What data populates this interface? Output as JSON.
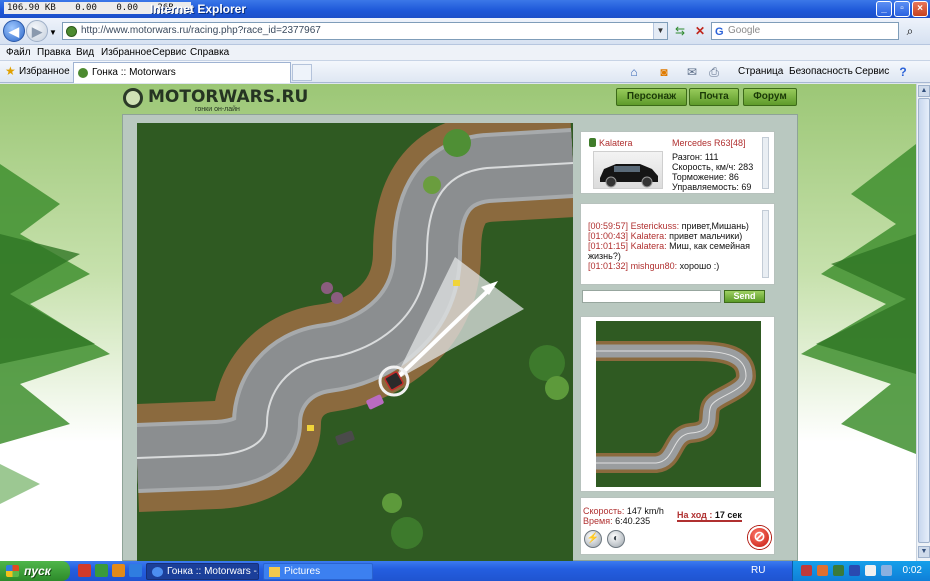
{
  "window": {
    "title": "Internet Explorer",
    "stats": [
      "106.90 KB",
      "0.00",
      "0.00",
      "26B"
    ]
  },
  "address": {
    "url": "http://www.motorwars.ru/racing.php?race_id=2377967",
    "search_placeholder": "Google"
  },
  "menu": [
    "Файл",
    "Правка",
    "Вид",
    "Избранное",
    "Сервис",
    "Справка"
  ],
  "favorites": {
    "label": "Избранное",
    "tab_title": "Гонка :: Motorwars"
  },
  "command_bar": [
    "Страница",
    "Безопасность",
    "Сервис"
  ],
  "site": {
    "logo": "MOTORWARS.RU",
    "logo_sub": "гонки он-лайн",
    "nav": [
      "Персонаж",
      "Почта",
      "Форум"
    ]
  },
  "car": {
    "owner": "Kalatera",
    "model": "Mercedes R63[48]",
    "stats": [
      "Разгон: 111",
      "Скорость, км/ч: 283",
      "Торможение: 86",
      "Управляемость: 69"
    ]
  },
  "chat": {
    "messages": [
      {
        "time": "[00:59:57]",
        "user": "Esterickuss:",
        "text": "привет,Мишань)"
      },
      {
        "time": "[01:00:43]",
        "user": "Kalatera:",
        "text": "привет мальчики)"
      },
      {
        "time": "[01:01:15]",
        "user": "Kalatera:",
        "text": "Миш, как семейная"
      },
      {
        "time": "",
        "user": "",
        "text": "жизнь?)"
      },
      {
        "time": "[01:01:32]",
        "user": "mishgun80:",
        "text": "хорошо :)"
      }
    ],
    "send_label": "Send"
  },
  "race": {
    "speed_label": "Скорость:",
    "speed_value": "147 km/h",
    "time_label": "Время:",
    "time_value": "6:40.235",
    "turn_label": "На ход :",
    "turn_value": "17 сек"
  },
  "taskbar": {
    "start": "пуск",
    "tasks": [
      "Гонка :: Motorwars -...",
      "Pictures"
    ],
    "lang": "RU",
    "clock": "0:02"
  },
  "colors": {
    "accent_green": "#5e9a2a",
    "grass": "#2f5a22",
    "asphalt": "#8b8e90",
    "label_red": "#b03030"
  }
}
